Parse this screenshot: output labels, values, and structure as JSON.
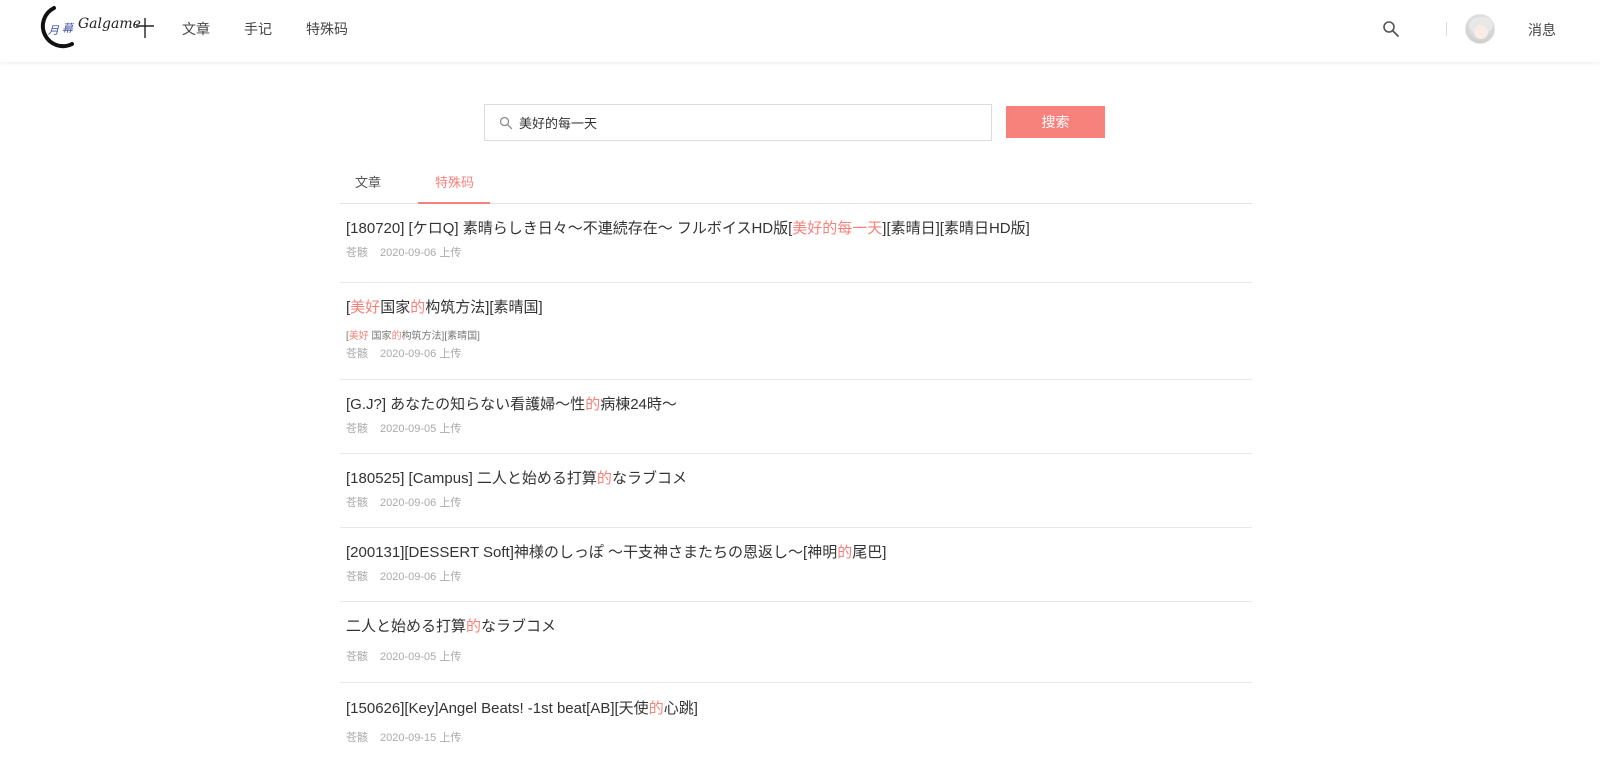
{
  "header": {
    "logo_text": "月幕 Galgame",
    "nav": [
      "文章",
      "手记",
      "特殊码"
    ],
    "messages_label": "消息"
  },
  "search": {
    "value": "美好的每一天",
    "button_label": "搜索"
  },
  "tabs": [
    {
      "label": "文章",
      "active": false
    },
    {
      "label": "特殊码",
      "active": true
    }
  ],
  "results": [
    {
      "title": [
        {
          "t": "[180720] [ケロQ] 素晴らしき日々～不連続存在～ フルボイスHD版["
        },
        {
          "t": "美好的每一天",
          "hl": true
        },
        {
          "t": "][素晴日][素晴日HD版]"
        }
      ],
      "author": "苍骸",
      "date": "2020-09-06 上传"
    },
    {
      "title": [
        {
          "t": "["
        },
        {
          "t": "美好",
          "hl": true
        },
        {
          "t": "国家"
        },
        {
          "t": "的",
          "hl": true
        },
        {
          "t": "构筑方法][素晴国]"
        }
      ],
      "sub": [
        {
          "t": "["
        },
        {
          "t": "美好",
          "hl": true
        },
        {
          "t": " 国家"
        },
        {
          "t": "的",
          "hl": true
        },
        {
          "t": "构筑方法][素晴国]"
        }
      ],
      "author": "苍骸",
      "date": "2020-09-06 上传"
    },
    {
      "title": [
        {
          "t": "[G.J?] あなたの知らない看護婦～性"
        },
        {
          "t": "的",
          "hl": true
        },
        {
          "t": "病棟24時～"
        }
      ],
      "author": "苍骸",
      "date": "2020-09-05 上传"
    },
    {
      "title": [
        {
          "t": "[180525] [Campus] 二人と始める打算"
        },
        {
          "t": "的",
          "hl": true
        },
        {
          "t": "なラブコメ"
        }
      ],
      "author": "苍骸",
      "date": "2020-09-06 上传"
    },
    {
      "title": [
        {
          "t": "[200131][DESSERT Soft]神様のしっぽ ～干支神さまたちの恩返し～[神明"
        },
        {
          "t": "的",
          "hl": true
        },
        {
          "t": "尾巴]"
        }
      ],
      "author": "苍骸",
      "date": "2020-09-06 上传"
    },
    {
      "title": [
        {
          "t": "二人と始める打算"
        },
        {
          "t": "的",
          "hl": true
        },
        {
          "t": "なラブコメ"
        }
      ],
      "author": "苍骸",
      "date": "2020-09-05 上传"
    },
    {
      "title": [
        {
          "t": "[150626][Key]Angel Beats! -1st beat[AB][天使"
        },
        {
          "t": "的",
          "hl": true
        },
        {
          "t": "心跳]"
        }
      ],
      "author": "苍骸",
      "date": "2020-09-15 上传"
    }
  ]
}
